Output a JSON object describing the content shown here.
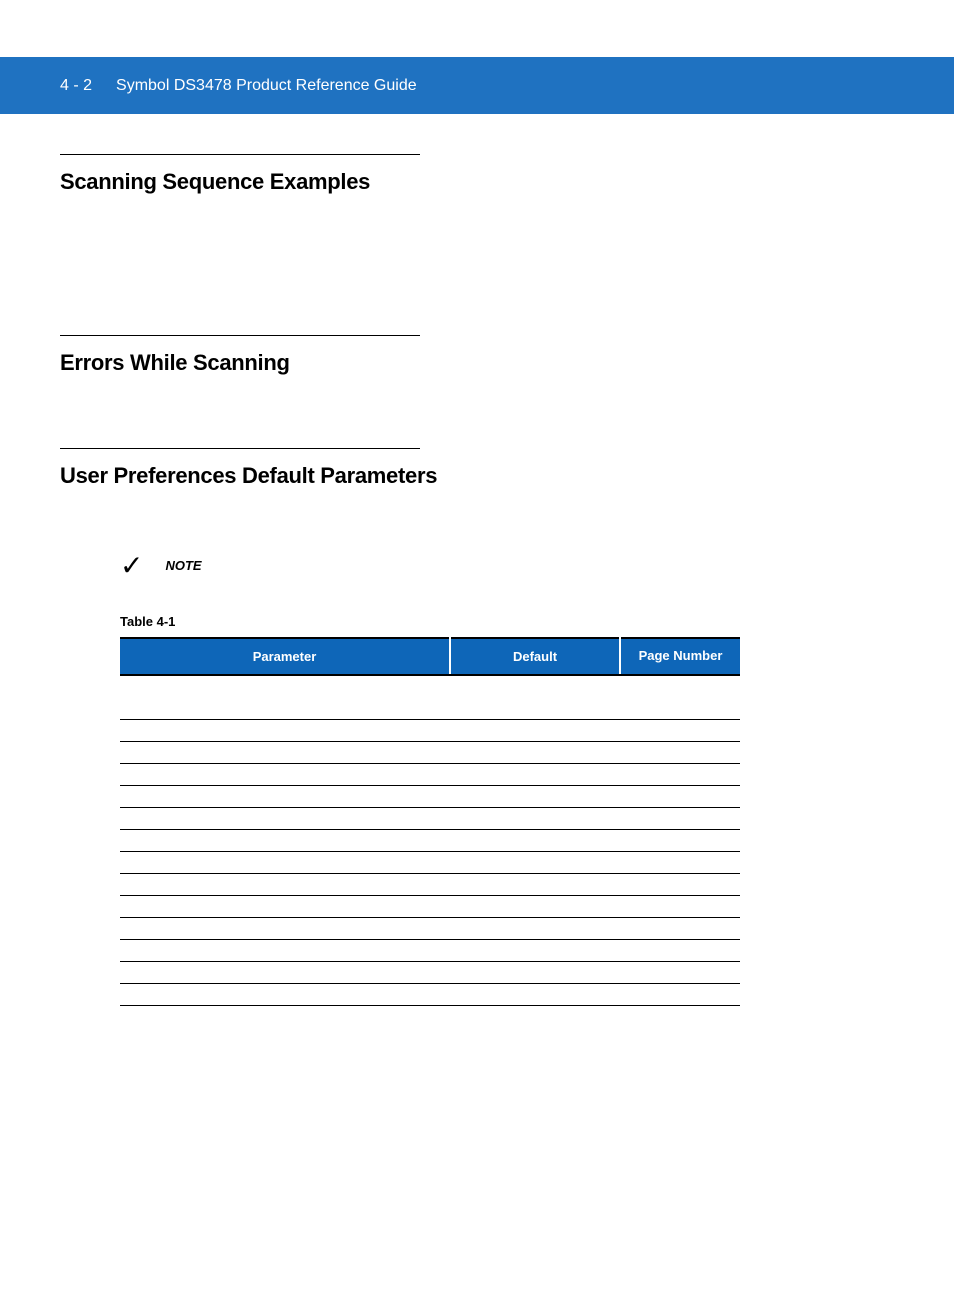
{
  "header": {
    "page_number": "4 - 2",
    "doc_title": "Symbol DS3478 Product Reference Guide"
  },
  "sections": [
    {
      "title": "Scanning Sequence Examples"
    },
    {
      "title": "Errors While Scanning"
    },
    {
      "title": "User Preferences Default Parameters"
    }
  ],
  "note": {
    "label": "NOTE"
  },
  "table": {
    "caption": "Table 4-1",
    "columns": {
      "parameter": "Parameter",
      "default": "Default",
      "page": "Page Number"
    },
    "rows": [
      {
        "type": "section",
        "parameter": "",
        "default": "",
        "page": ""
      },
      {
        "type": "data",
        "parameter": "",
        "default": "",
        "page": ""
      },
      {
        "type": "data",
        "parameter": "",
        "default": "",
        "page": ""
      },
      {
        "type": "data",
        "parameter": "",
        "default": "",
        "page": ""
      },
      {
        "type": "data",
        "parameter": "",
        "default": "",
        "page": ""
      },
      {
        "type": "data",
        "parameter": "",
        "default": "",
        "page": ""
      },
      {
        "type": "data",
        "parameter": "",
        "default": "",
        "page": ""
      },
      {
        "type": "data",
        "parameter": "",
        "default": "",
        "page": ""
      },
      {
        "type": "data",
        "parameter": "",
        "default": "",
        "page": ""
      },
      {
        "type": "data",
        "parameter": "",
        "default": "",
        "page": ""
      },
      {
        "type": "data",
        "parameter": "",
        "default": "",
        "page": ""
      },
      {
        "type": "data",
        "parameter": "",
        "default": "",
        "page": ""
      },
      {
        "type": "data",
        "parameter": "",
        "default": "",
        "page": ""
      },
      {
        "type": "data",
        "parameter": "",
        "default": "",
        "page": ""
      },
      {
        "type": "data",
        "parameter": "",
        "default": "",
        "page": ""
      }
    ]
  }
}
